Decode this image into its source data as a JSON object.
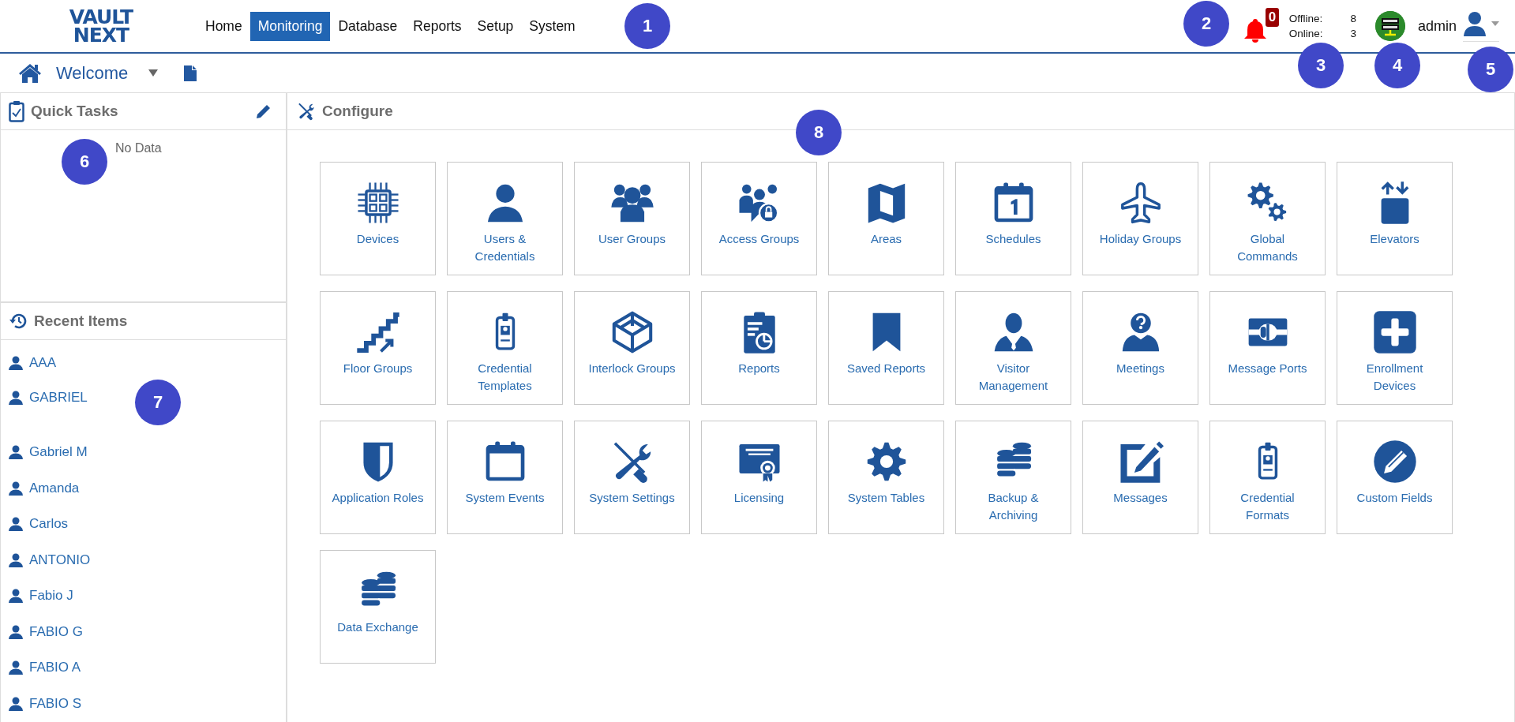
{
  "header": {
    "logo": [
      "VAULT",
      "NEXT"
    ],
    "nav": [
      {
        "label": "Home",
        "selected": false
      },
      {
        "label": "Monitoring",
        "selected": true
      },
      {
        "label": "Database",
        "selected": false
      },
      {
        "label": "Reports",
        "selected": false
      },
      {
        "label": "Setup",
        "selected": false
      },
      {
        "label": "System",
        "selected": false
      }
    ],
    "notifications": {
      "count": "0"
    },
    "device_status": [
      {
        "label": "Offline:",
        "value": "8"
      },
      {
        "label": "Online:",
        "value": "3"
      }
    ],
    "user": {
      "name": "admin"
    }
  },
  "breadcrumb": {
    "title": "Welcome"
  },
  "quick_tasks": {
    "title": "Quick Tasks",
    "empty_text": "No Data"
  },
  "recent_items": {
    "title": "Recent Items",
    "items": [
      "AAA",
      "GABRIEL",
      "Gabriel M",
      "Amanda",
      "Carlos",
      "ANTONIO",
      "Fabio J",
      "FABIO G",
      "FABIO A",
      "FABIO S"
    ]
  },
  "configure": {
    "title": "Configure",
    "tiles": [
      {
        "label": "Devices"
      },
      {
        "label": "Users &\nCredentials"
      },
      {
        "label": "User Groups"
      },
      {
        "label": "Access Groups"
      },
      {
        "label": "Areas"
      },
      {
        "label": "Schedules"
      },
      {
        "label": "Holiday Groups"
      },
      {
        "label": "Global\nCommands"
      },
      {
        "label": "Elevators"
      },
      {
        "label": "Floor Groups"
      },
      {
        "label": "Credential\nTemplates"
      },
      {
        "label": "Interlock Groups"
      },
      {
        "label": "Reports"
      },
      {
        "label": "Saved Reports"
      },
      {
        "label": "Visitor\nManagement"
      },
      {
        "label": "Meetings"
      },
      {
        "label": "Message Ports"
      },
      {
        "label": "Enrollment\nDevices"
      },
      {
        "label": "Application Roles"
      },
      {
        "label": "System Events"
      },
      {
        "label": "System Settings"
      },
      {
        "label": "Licensing"
      },
      {
        "label": "System Tables"
      },
      {
        "label": "Backup &\nArchiving"
      },
      {
        "label": "Messages"
      },
      {
        "label": "Credential\nFormats"
      },
      {
        "label": "Custom Fields"
      },
      {
        "label": "Data Exchange"
      }
    ]
  },
  "callouts": [
    "1",
    "2",
    "3",
    "4",
    "5",
    "6",
    "7",
    "8"
  ]
}
